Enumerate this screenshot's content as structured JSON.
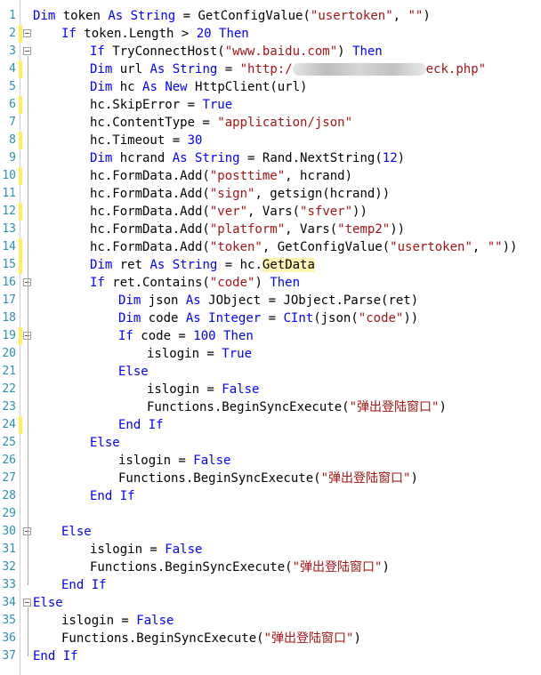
{
  "editor": {
    "lines": [
      {
        "n": "1",
        "segments": [
          {
            "t": "Dim",
            "c": "kw"
          },
          {
            "t": " token "
          },
          {
            "t": "As",
            "c": "kw"
          },
          {
            "t": " "
          },
          {
            "t": "String",
            "c": "kw"
          },
          {
            "t": " = GetConfigValue("
          },
          {
            "t": "\"usertoken\"",
            "c": "str"
          },
          {
            "t": ", "
          },
          {
            "t": "\"\"",
            "c": "str"
          },
          {
            "t": ")"
          }
        ]
      },
      {
        "n": "2",
        "segments": [
          {
            "t": "If",
            "c": "kw"
          },
          {
            "t": " token.Length > "
          },
          {
            "t": "20",
            "c": "kw"
          },
          {
            "t": " "
          },
          {
            "t": "Then",
            "c": "kw"
          }
        ]
      },
      {
        "n": "3",
        "segments": [
          {
            "t": "If",
            "c": "kw"
          },
          {
            "t": " TryConnectHost("
          },
          {
            "t": "\"www.baidu.com\"",
            "c": "str"
          },
          {
            "t": ") "
          },
          {
            "t": "Then",
            "c": "kw"
          }
        ]
      },
      {
        "n": "4",
        "segments": [
          {
            "t": "Dim",
            "c": "kw"
          },
          {
            "t": " url "
          },
          {
            "t": "As",
            "c": "kw"
          },
          {
            "t": " "
          },
          {
            "t": "String",
            "c": "kw"
          },
          {
            "t": " = "
          },
          {
            "t": "\"http:/",
            "c": "str"
          },
          {
            "t": "",
            "c": "blur"
          },
          {
            "t": "eck.php\"",
            "c": "str"
          }
        ]
      },
      {
        "n": "5",
        "segments": [
          {
            "t": "Dim",
            "c": "kw"
          },
          {
            "t": " hc "
          },
          {
            "t": "As",
            "c": "kw"
          },
          {
            "t": " "
          },
          {
            "t": "New",
            "c": "kw"
          },
          {
            "t": " HttpClient(url)"
          }
        ]
      },
      {
        "n": "6",
        "segments": [
          {
            "t": "hc.SkipError = "
          },
          {
            "t": "True",
            "c": "kw"
          }
        ]
      },
      {
        "n": "7",
        "segments": [
          {
            "t": "hc.ContentType = "
          },
          {
            "t": "\"application/json\"",
            "c": "str"
          }
        ]
      },
      {
        "n": "8",
        "segments": [
          {
            "t": "hc.Timeout = "
          },
          {
            "t": "30",
            "c": "kw"
          }
        ]
      },
      {
        "n": "9",
        "segments": [
          {
            "t": "Dim",
            "c": "kw"
          },
          {
            "t": " hcrand "
          },
          {
            "t": "As",
            "c": "kw"
          },
          {
            "t": " "
          },
          {
            "t": "String",
            "c": "kw"
          },
          {
            "t": " = Rand.NextString("
          },
          {
            "t": "12",
            "c": "kw"
          },
          {
            "t": ")"
          }
        ]
      },
      {
        "n": "10",
        "segments": [
          {
            "t": "hc.FormData.Add("
          },
          {
            "t": "\"posttime\"",
            "c": "str"
          },
          {
            "t": ", hcrand)"
          }
        ]
      },
      {
        "n": "11",
        "segments": [
          {
            "t": "hc.FormData.Add("
          },
          {
            "t": "\"sign\"",
            "c": "str"
          },
          {
            "t": ", getsign(hcrand))"
          }
        ]
      },
      {
        "n": "12",
        "segments": [
          {
            "t": "hc.FormData.Add("
          },
          {
            "t": "\"ver\"",
            "c": "str"
          },
          {
            "t": ", Vars("
          },
          {
            "t": "\"sfver\"",
            "c": "str"
          },
          {
            "t": "))"
          }
        ]
      },
      {
        "n": "13",
        "segments": [
          {
            "t": "hc.FormData.Add("
          },
          {
            "t": "\"platform\"",
            "c": "str"
          },
          {
            "t": ", Vars("
          },
          {
            "t": "\"temp2\"",
            "c": "str"
          },
          {
            "t": "))"
          }
        ]
      },
      {
        "n": "14",
        "segments": [
          {
            "t": "hc.FormData.Add("
          },
          {
            "t": "\"token\"",
            "c": "str"
          },
          {
            "t": ", GetConfigValue("
          },
          {
            "t": "\"usertoken\"",
            "c": "str"
          },
          {
            "t": ", "
          },
          {
            "t": "\"\"",
            "c": "str"
          },
          {
            "t": "))"
          }
        ]
      },
      {
        "n": "15",
        "segments": [
          {
            "t": "Dim",
            "c": "kw"
          },
          {
            "t": " ret "
          },
          {
            "t": "As",
            "c": "kw"
          },
          {
            "t": " "
          },
          {
            "t": "String",
            "c": "kw"
          },
          {
            "t": " = hc."
          },
          {
            "t": "GetData",
            "c": "hl"
          }
        ]
      },
      {
        "n": "16",
        "segments": [
          {
            "t": "If",
            "c": "kw"
          },
          {
            "t": " ret.Contains("
          },
          {
            "t": "\"code\"",
            "c": "str"
          },
          {
            "t": ") "
          },
          {
            "t": "Then",
            "c": "kw"
          }
        ]
      },
      {
        "n": "17",
        "segments": [
          {
            "t": "Dim",
            "c": "kw"
          },
          {
            "t": " json "
          },
          {
            "t": "As",
            "c": "kw"
          },
          {
            "t": " JObject = JObject.Parse(ret)"
          }
        ]
      },
      {
        "n": "18",
        "segments": [
          {
            "t": "Dim",
            "c": "kw"
          },
          {
            "t": " code "
          },
          {
            "t": "As",
            "c": "kw"
          },
          {
            "t": " "
          },
          {
            "t": "Integer",
            "c": "kw"
          },
          {
            "t": " = "
          },
          {
            "t": "CInt",
            "c": "kw"
          },
          {
            "t": "(json("
          },
          {
            "t": "\"code\"",
            "c": "str"
          },
          {
            "t": "))"
          }
        ]
      },
      {
        "n": "19",
        "segments": [
          {
            "t": "If",
            "c": "kw"
          },
          {
            "t": " code = "
          },
          {
            "t": "100",
            "c": "kw"
          },
          {
            "t": " "
          },
          {
            "t": "Then",
            "c": "kw"
          }
        ]
      },
      {
        "n": "20",
        "segments": [
          {
            "t": "islogin = "
          },
          {
            "t": "True",
            "c": "kw"
          }
        ]
      },
      {
        "n": "21",
        "segments": [
          {
            "t": "Else",
            "c": "kw"
          }
        ]
      },
      {
        "n": "22",
        "segments": [
          {
            "t": "islogin = "
          },
          {
            "t": "False",
            "c": "kw"
          }
        ]
      },
      {
        "n": "23",
        "segments": [
          {
            "t": "Functions.BeginSyncExecute("
          },
          {
            "t": "\"弹出登陆窗口\"",
            "c": "str"
          },
          {
            "t": ")"
          }
        ]
      },
      {
        "n": "24",
        "segments": [
          {
            "t": "End If",
            "c": "kw"
          }
        ]
      },
      {
        "n": "25",
        "segments": [
          {
            "t": "Else",
            "c": "kw"
          }
        ]
      },
      {
        "n": "26",
        "segments": [
          {
            "t": "islogin = "
          },
          {
            "t": "False",
            "c": "kw"
          }
        ]
      },
      {
        "n": "27",
        "segments": [
          {
            "t": "Functions.BeginSyncExecute("
          },
          {
            "t": "\"弹出登陆窗口\"",
            "c": "str"
          },
          {
            "t": ")"
          }
        ]
      },
      {
        "n": "28",
        "segments": [
          {
            "t": "End If",
            "c": "kw"
          }
        ]
      },
      {
        "n": "29",
        "segments": []
      },
      {
        "n": "30",
        "segments": [
          {
            "t": "Else",
            "c": "kw"
          }
        ]
      },
      {
        "n": "31",
        "segments": [
          {
            "t": "islogin = "
          },
          {
            "t": "False",
            "c": "kw"
          }
        ]
      },
      {
        "n": "32",
        "segments": [
          {
            "t": "Functions.BeginSyncExecute("
          },
          {
            "t": "\"弹出登陆窗口\"",
            "c": "str"
          },
          {
            "t": ")"
          }
        ]
      },
      {
        "n": "33",
        "segments": [
          {
            "t": "End If",
            "c": "kw"
          }
        ]
      },
      {
        "n": "34",
        "segments": [
          {
            "t": "Else",
            "c": "kw"
          }
        ]
      },
      {
        "n": "35",
        "segments": [
          {
            "t": "islogin = "
          },
          {
            "t": "False",
            "c": "kw"
          }
        ]
      },
      {
        "n": "36",
        "segments": [
          {
            "t": "Functions.BeginSyncExecute("
          },
          {
            "t": "\"弹出登陆窗口\"",
            "c": "str"
          },
          {
            "t": ")"
          }
        ]
      },
      {
        "n": "37",
        "segments": [
          {
            "t": "End If",
            "c": "kw"
          }
        ]
      }
    ]
  },
  "colors": {
    "keyword": "#0000ff",
    "string": "#a31515",
    "line_number": "#2b91af",
    "modified_marker": "#ffee62"
  }
}
